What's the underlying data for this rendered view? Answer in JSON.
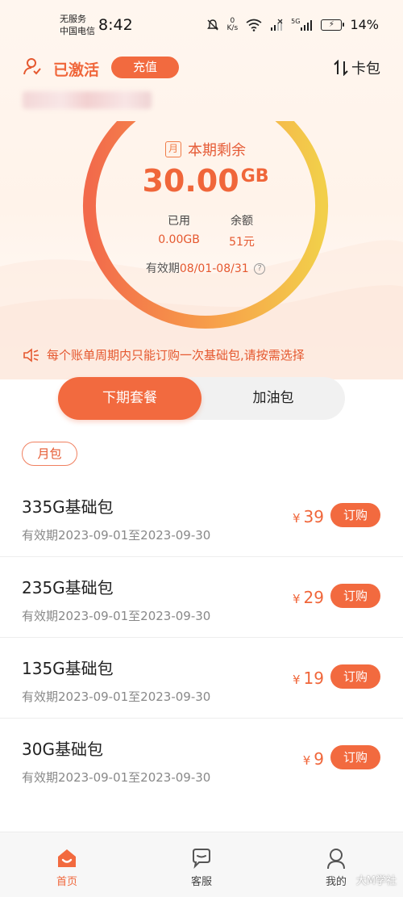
{
  "status_bar": {
    "carrier_line1": "无服务",
    "carrier_line2": "中国电信",
    "time": "8:42",
    "net_speed_value": "0",
    "net_speed_unit": "K/s",
    "signal_label": "5G",
    "battery": "14%"
  },
  "header": {
    "status": "已激活",
    "recharge": "充值",
    "cardpack": "卡包"
  },
  "quota": {
    "period_icon": "月",
    "title": "本期剩余",
    "remaining_value": "30.00",
    "remaining_unit": "GB",
    "used_label": "已用",
    "used_value": "0.00GB",
    "balance_label": "余额",
    "balance_value": "51元",
    "validity_label": "有效期",
    "validity_dates": "08/01-08/31",
    "help_icon": "?",
    "remaining_fraction": 1.0,
    "colors": {
      "start": "#f26a4b",
      "mid": "#f7a14a",
      "end": "#f2cf4a"
    }
  },
  "notice": "每个账单周期内只能订购一次基础包,请按需选择",
  "tabs": [
    "下期套餐",
    "加油包"
  ],
  "category": "月包",
  "packages": [
    {
      "name": "335G基础包",
      "validity": "有效期2023-09-01至2023-09-30",
      "yen": "¥",
      "price": "39",
      "order": "订购"
    },
    {
      "name": "235G基础包",
      "validity": "有效期2023-09-01至2023-09-30",
      "yen": "¥",
      "price": "29",
      "order": "订购"
    },
    {
      "name": "135G基础包",
      "validity": "有效期2023-09-01至2023-09-30",
      "yen": "¥",
      "price": "19",
      "order": "订购"
    },
    {
      "name": "30G基础包",
      "validity": "有效期2023-09-01至2023-09-30",
      "yen": "¥",
      "price": "9",
      "order": "订购"
    }
  ],
  "bottom_nav": {
    "home": "首页",
    "service": "客服",
    "mine": "我的"
  },
  "watermark": "大M学社",
  "accent_color": "#f26a3f"
}
